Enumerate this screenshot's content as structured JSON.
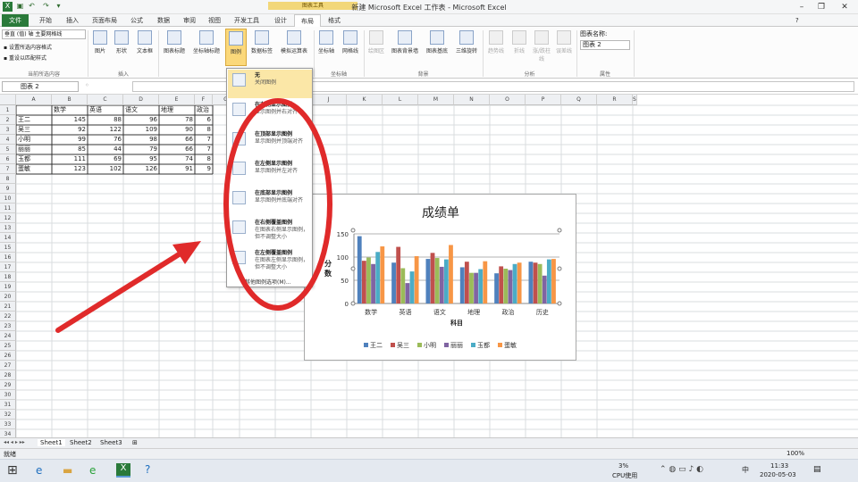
{
  "window": {
    "title": "新建 Microsoft Excel 工作表 - Microsoft Excel",
    "context_tab_group": "图表工具"
  },
  "tabs": [
    "文件",
    "开始",
    "插入",
    "页面布局",
    "公式",
    "数据",
    "审阅",
    "视图",
    "开发工具",
    "设计",
    "布局",
    "格式"
  ],
  "ribbon": {
    "current_selection": {
      "dropdown": "垂直 (值) 轴 主要网格线",
      "format_btn": "设置所选内容格式",
      "reset_btn": "重设以匹配样式",
      "group": "当前所选内容"
    },
    "insert": {
      "buttons": [
        "图片",
        "形状",
        "文本框"
      ],
      "group": "插入"
    },
    "labels": {
      "buttons": [
        "图表标题",
        "坐标轴标题",
        "图例",
        "数据标签",
        "模拟运算表"
      ]
    },
    "axes": {
      "buttons": [
        "坐标轴",
        "网格线"
      ],
      "group": "坐标轴"
    },
    "background": {
      "buttons": [
        "绘图区",
        "图表背景墙",
        "图表基底",
        "三维旋转"
      ],
      "group": "背景"
    },
    "analysis": {
      "buttons": [
        "趋势线",
        "折线",
        "涨/跌柱线",
        "误差线"
      ],
      "group": "分析"
    },
    "properties": {
      "label": "图表名称:",
      "value": "图表 2",
      "group": "属性"
    }
  },
  "namebox": "图表 2",
  "columns": [
    "A",
    "B",
    "C",
    "D",
    "E",
    "F",
    "G",
    "H",
    "I",
    "J",
    "K",
    "L",
    "M",
    "N",
    "O",
    "P",
    "Q",
    "R",
    "S"
  ],
  "rows": [
    "1",
    "2",
    "3",
    "4",
    "5",
    "6",
    "7",
    "8",
    "9",
    "10",
    "11",
    "12",
    "13",
    "14",
    "15",
    "16",
    "17",
    "18",
    "19",
    "20",
    "21",
    "22",
    "23",
    "24",
    "25",
    "26",
    "27",
    "28",
    "29",
    "30",
    "31",
    "32",
    "33",
    "34"
  ],
  "table": {
    "headers": [
      "",
      "数学",
      "英语",
      "语文",
      "地理",
      "政治"
    ],
    "rows": [
      [
        "王二",
        "145",
        "88",
        "96",
        "78",
        "6"
      ],
      [
        "吴三",
        "92",
        "122",
        "109",
        "90",
        "8"
      ],
      [
        "小明",
        "99",
        "76",
        "98",
        "66",
        "7"
      ],
      [
        "丽丽",
        "85",
        "44",
        "79",
        "66",
        "7"
      ],
      [
        "玉都",
        "111",
        "69",
        "95",
        "74",
        "8"
      ],
      [
        "蛋敏",
        "123",
        "102",
        "126",
        "91",
        "9"
      ]
    ]
  },
  "legend_menu": [
    {
      "title": "无",
      "desc": "关闭图例"
    },
    {
      "title": "在右侧显示图例",
      "desc": "显示图例并右对齐"
    },
    {
      "title": "在顶部显示图例",
      "desc": "显示图例并顶端对齐"
    },
    {
      "title": "在左侧显示图例",
      "desc": "显示图例并左对齐"
    },
    {
      "title": "在底部显示图例",
      "desc": "显示图例并底端对齐"
    },
    {
      "title": "在右侧覆盖图例",
      "desc": "在图表右侧显示图例，但不调整大小"
    },
    {
      "title": "在左侧覆盖图例",
      "desc": "在图表左侧显示图例，但不调整大小"
    }
  ],
  "legend_menu_more": "其他图例选项(M)...",
  "chart_data": {
    "type": "bar",
    "title": "成绩单",
    "xlabel": "科目",
    "ylabel": "分数",
    "ylim": [
      0,
      150
    ],
    "yticks": [
      0,
      50,
      100,
      150
    ],
    "categories": [
      "数学",
      "英语",
      "语文",
      "地理",
      "政治",
      "历史"
    ],
    "series": [
      {
        "name": "王二",
        "color": "#4f81bd",
        "values": [
          145,
          88,
          96,
          78,
          65,
          90
        ]
      },
      {
        "name": "吴三",
        "color": "#c0504d",
        "values": [
          92,
          122,
          109,
          90,
          80,
          88
        ]
      },
      {
        "name": "小明",
        "color": "#9bbb59",
        "values": [
          99,
          76,
          98,
          66,
          75,
          85
        ]
      },
      {
        "name": "丽丽",
        "color": "#8064a2",
        "values": [
          85,
          44,
          79,
          66,
          72,
          60
        ]
      },
      {
        "name": "玉都",
        "color": "#4bacc6",
        "values": [
          111,
          69,
          95,
          74,
          85,
          95
        ]
      },
      {
        "name": "蛋敏",
        "color": "#f79646",
        "values": [
          123,
          102,
          126,
          91,
          88,
          96
        ]
      }
    ],
    "legend_position": "bottom",
    "grid": true
  },
  "sheets": [
    "Sheet1",
    "Sheet2",
    "Sheet3"
  ],
  "status": {
    "ready": "就绪",
    "zoom": "100%"
  },
  "taskbar": {
    "cpu": "3%",
    "cpu_label": "CPU使用",
    "time": "11:33",
    "date": "2020-05-03",
    "ime": "中"
  },
  "colors": {
    "arrow": "#e02a2a",
    "file_tab": "#2a7a3a",
    "context": "#f2d779"
  }
}
